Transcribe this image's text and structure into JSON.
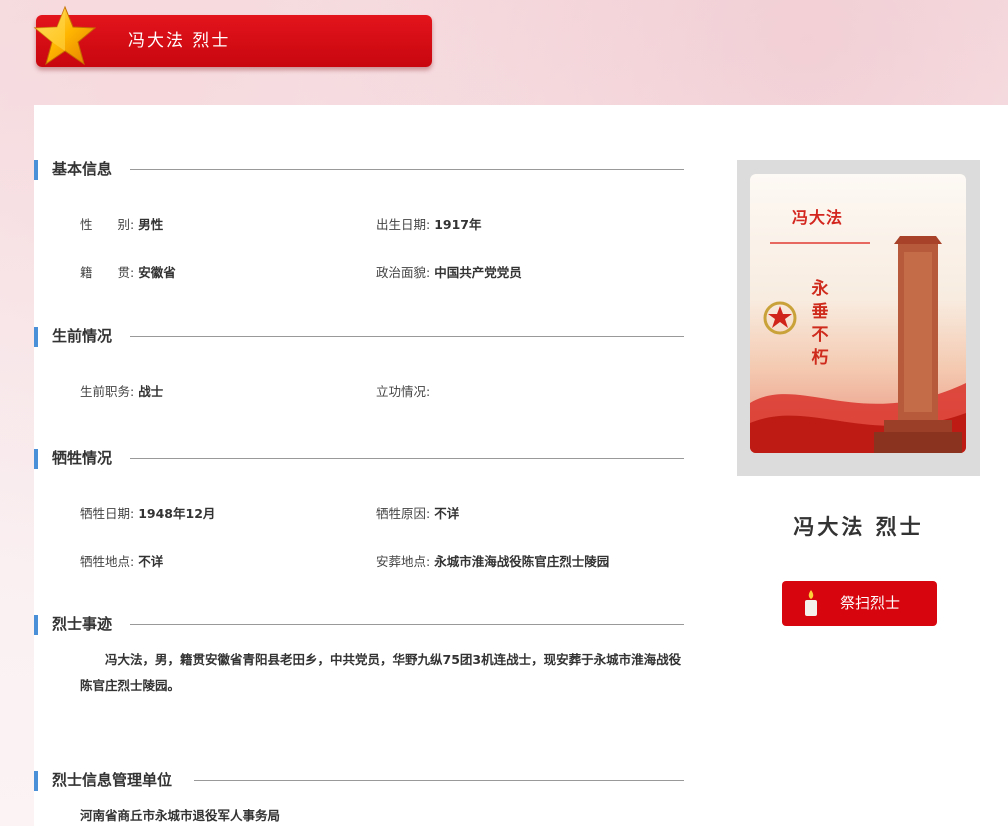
{
  "header": {
    "title": "冯大法 烈士"
  },
  "sections": {
    "basic": "基本信息",
    "life": "生前情况",
    "sacrifice": "牺牲情况",
    "deeds": "烈士事迹",
    "management": "烈士信息管理单位"
  },
  "basic": {
    "gender_label": "性　　别:",
    "gender_value": "男性",
    "birth_label": "出生日期:",
    "birth_value": "1917年",
    "native_label": "籍　　贯:",
    "native_value": "安徽省",
    "political_label": "政治面貌:",
    "political_value": "中国共产党党员"
  },
  "life": {
    "post_label": "生前职务:",
    "post_value": "战士",
    "merit_label": "立功情况:",
    "merit_value": ""
  },
  "sacrifice": {
    "date_label": "牺牲日期:",
    "date_value": "1948年12月",
    "reason_label": "牺牲原因:",
    "reason_value": "不详",
    "place_label": "牺牲地点:",
    "place_value": "不详",
    "burial_label": "安葬地点:",
    "burial_value": "永城市淮海战役陈官庄烈士陵园"
  },
  "deeds": {
    "text": "冯大法，男，籍贯安徽省青阳县老田乡，中共党员，华野九纵75团3机连战士，现安葬于永城市淮海战役陈官庄烈士陵园。"
  },
  "management": {
    "org": "河南省商丘市永城市退役军人事务局"
  },
  "card": {
    "photo_name": "冯大法",
    "slogan": [
      "永",
      "垂",
      "不",
      "朽"
    ],
    "name_title": "冯大法 烈士",
    "tribute_button": "祭扫烈士"
  },
  "colors": {
    "accent_red": "#d7060e",
    "section_blue": "#4a90d9"
  },
  "icons": {
    "banner": "star-icon",
    "tribute": "candle-icon",
    "photo": [
      "emblem-icon",
      "monument-icon"
    ]
  }
}
